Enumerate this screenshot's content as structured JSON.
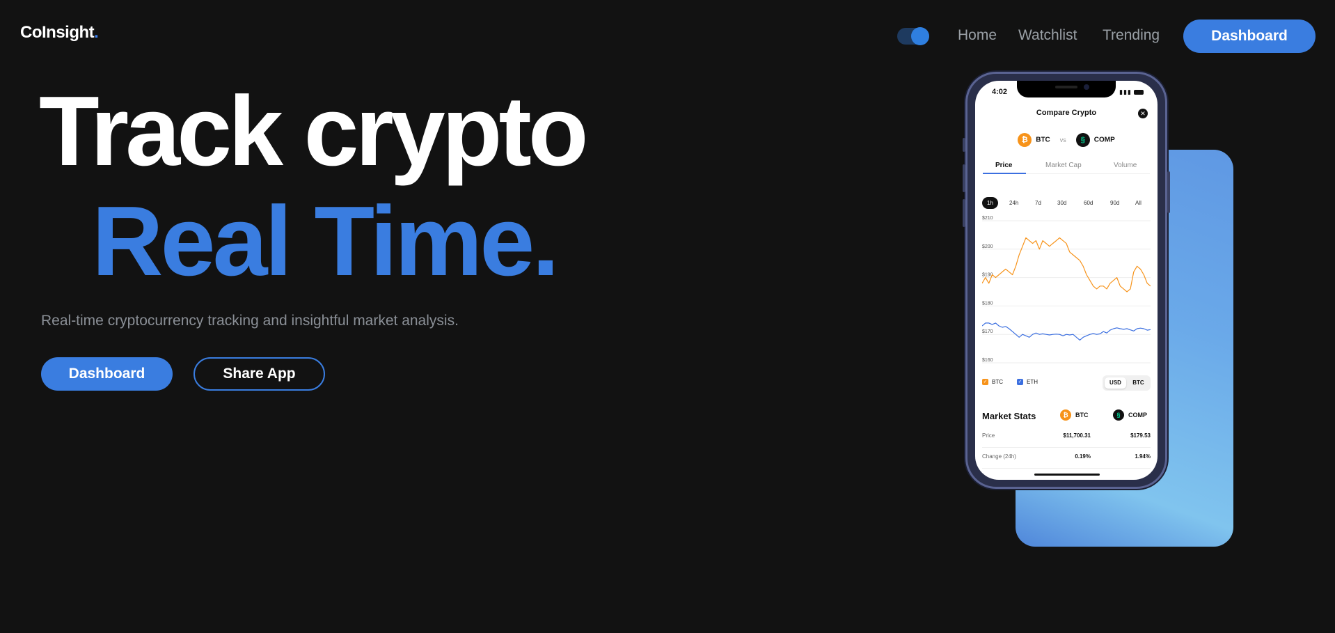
{
  "brand": {
    "name": "CoInsight",
    "dot": "."
  },
  "nav": {
    "links": [
      "Home",
      "Watchlist",
      "Trending"
    ],
    "dashboard_label": "Dashboard",
    "theme_toggle": "on"
  },
  "hero": {
    "line1": "Track crypto",
    "line2": "Real Time.",
    "subtitle": "Real-time cryptocurrency tracking and insightful market analysis.",
    "primary_label": "Dashboard",
    "secondary_label": "Share App"
  },
  "phone": {
    "status_time": "4:02",
    "title": "Compare Crypto",
    "coin_a": "BTC",
    "vs": "vs",
    "coin_b": "COMP",
    "tabs": [
      "Price",
      "Market Cap",
      "Volume"
    ],
    "ranges": [
      "1h",
      "24h",
      "7d",
      "30d",
      "60d",
      "90d",
      "All"
    ],
    "legend": [
      "BTC",
      "ETH"
    ],
    "currency": [
      "USD",
      "BTC"
    ],
    "market_stats": {
      "title": "Market Stats",
      "coin_a": "BTC",
      "coin_b": "COMP",
      "rows": [
        {
          "label": "Price",
          "a": "$11,700.31",
          "b": "$179.53"
        },
        {
          "label": "Change (24h)",
          "a": "0.19%",
          "b": "1.94%"
        }
      ]
    }
  },
  "colors": {
    "accent": "#3a7de0",
    "btc": "#f7931a",
    "eth": "#3b6fe0",
    "background": "#121212"
  },
  "chart_data": {
    "type": "line",
    "yticks": [
      "$210",
      "$200",
      "$190",
      "$180",
      "$170",
      "$160"
    ],
    "ylim": [
      160,
      210
    ],
    "series": [
      {
        "name": "BTC",
        "color": "#f7931a",
        "values": [
          188,
          190,
          188,
          191,
          190,
          191,
          192,
          193,
          192,
          191,
          194,
          198,
          201,
          204,
          203,
          202,
          203,
          200,
          203,
          202,
          201,
          202,
          203,
          204,
          203,
          202,
          199,
          198,
          197,
          196,
          194,
          191,
          189,
          187,
          186,
          187,
          187,
          186,
          188,
          189,
          190,
          187,
          186,
          185,
          186,
          192,
          194,
          193,
          191,
          188,
          187
        ]
      },
      {
        "name": "ETH",
        "color": "#3b6fe0",
        "values": [
          173,
          174,
          174,
          173.5,
          174,
          173,
          172.5,
          172.8,
          172,
          171,
          170,
          169,
          170,
          169.5,
          169,
          170,
          170.5,
          170,
          170.2,
          170,
          169.8,
          170,
          170.1,
          170,
          169.5,
          170,
          169.8,
          170,
          169,
          168,
          169,
          169.5,
          170,
          170.3,
          170,
          170.2,
          171,
          170.5,
          171.5,
          172,
          172.3,
          172,
          171.8,
          172,
          171.6,
          171.2,
          172,
          172.2,
          172,
          171.5,
          171.7
        ]
      }
    ]
  }
}
